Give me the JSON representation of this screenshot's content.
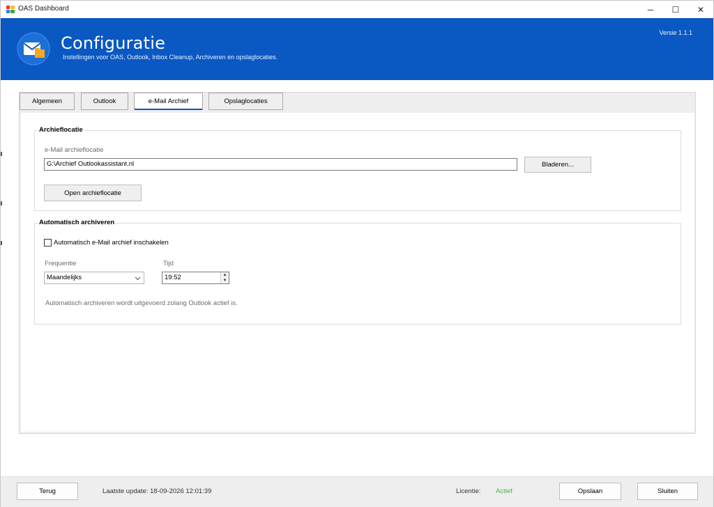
{
  "window": {
    "title": "OAS Dashboard",
    "controls": {
      "minimize": "─",
      "maximize": "☐",
      "close": "✕"
    }
  },
  "header": {
    "title": "Configuratie",
    "subtitle": "Instellingen voor OAS, Outlook, Inbox Cleanup, Archiveren en opslaglocaties.",
    "version": "Versie 1.1.1",
    "accent_color": "#0a58c2"
  },
  "tabs": [
    {
      "label": "Algemeen",
      "active": false
    },
    {
      "label": "Outlook",
      "active": false
    },
    {
      "label": "e-Mail Archief",
      "active": true
    },
    {
      "label": "Opslaglocaties",
      "active": false
    }
  ],
  "archive_location": {
    "group_title": "Archieflocatie",
    "field_label": "e-Mail archieflocatie",
    "field_value": "G:\\Archief Outlookassistant.nl",
    "browse_label": "Bladeren...",
    "open_label": "Open archieflocatie"
  },
  "auto_archive": {
    "group_title": "Automatisch archiveren",
    "enable_label": "Automatisch e-Mail archief inschakelen",
    "enabled": false,
    "frequency_label": "Frequentie",
    "frequency_value": "Maandelijks",
    "time_label": "Tijd",
    "time_value": "19:52",
    "note": "Automatisch archiveren wordt uitgevoerd zolang Outlook actief is."
  },
  "footer": {
    "back_label": "Terug",
    "last_update": "Laatste update: 18-09-2026 12:01:39",
    "license_label": "Licentie:",
    "license_status": "Actief",
    "license_status_color": "#4caf50",
    "save_label": "Opslaan",
    "close_label": "Sluiten"
  }
}
